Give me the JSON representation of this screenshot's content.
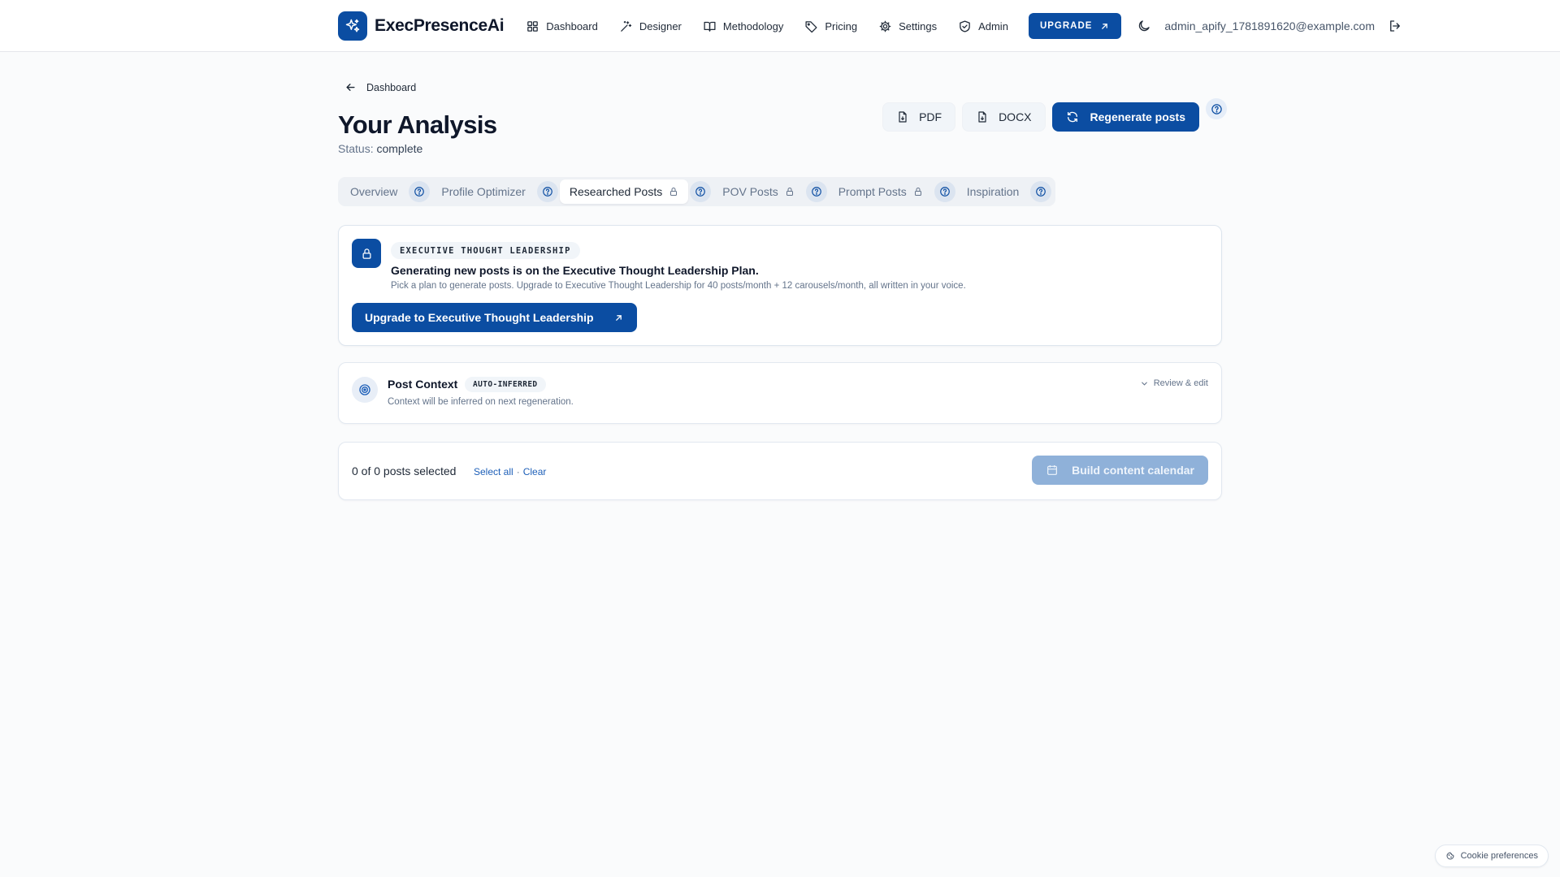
{
  "header": {
    "brand_name": "ExecPresenceAi",
    "nav": [
      {
        "label": "Dashboard",
        "icon": "dashboard-grid-icon"
      },
      {
        "label": "Designer",
        "icon": "wand-icon"
      },
      {
        "label": "Methodology",
        "icon": "book-icon"
      },
      {
        "label": "Pricing",
        "icon": "tag-icon"
      },
      {
        "label": "Settings",
        "icon": "gear-icon"
      },
      {
        "label": "Admin",
        "icon": "shield-check-icon"
      }
    ],
    "upgrade_label": "UPGRADE",
    "user_email": "admin_apify_1781891620@example.com"
  },
  "breadcrumb": {
    "label": "Dashboard"
  },
  "page": {
    "title": "Your Analysis",
    "status_label": "Status:",
    "status_value": "complete"
  },
  "actions": {
    "pdf_label": "PDF",
    "docx_label": "DOCX",
    "regenerate_label": "Regenerate posts"
  },
  "tabs": [
    {
      "label": "Overview",
      "active": false,
      "locked": false
    },
    {
      "label": "Profile Optimizer",
      "active": false,
      "locked": false
    },
    {
      "label": "Researched Posts",
      "active": true,
      "locked": true
    },
    {
      "label": "POV Posts",
      "active": false,
      "locked": true
    },
    {
      "label": "Prompt Posts",
      "active": false,
      "locked": true
    },
    {
      "label": "Inspiration",
      "active": false,
      "locked": false
    }
  ],
  "upgrade_card": {
    "badge": "EXECUTIVE THOUGHT LEADERSHIP",
    "heading": "Generating new posts is on the Executive Thought Leadership Plan.",
    "description": "Pick a plan to generate posts. Upgrade to Executive Thought Leadership for 40 posts/month + 12 carousels/month, all written in your voice.",
    "cta_label": "Upgrade to Executive Thought Leadership"
  },
  "context_card": {
    "title": "Post Context",
    "badge": "AUTO-INFERRED",
    "description": "Context will be inferred on next regeneration.",
    "review_label": "Review & edit"
  },
  "selection": {
    "count_text": "0 of 0 posts selected",
    "select_all": "Select all",
    "separator": "·",
    "clear": "Clear",
    "build_label": "Build content calendar"
  },
  "cookie": {
    "label": "Cookie preferences"
  },
  "colors": {
    "brand": "#0b4da2",
    "background": "#fafbfc",
    "link": "#1d5fb8",
    "disabled_button": "#8fb1d9"
  }
}
